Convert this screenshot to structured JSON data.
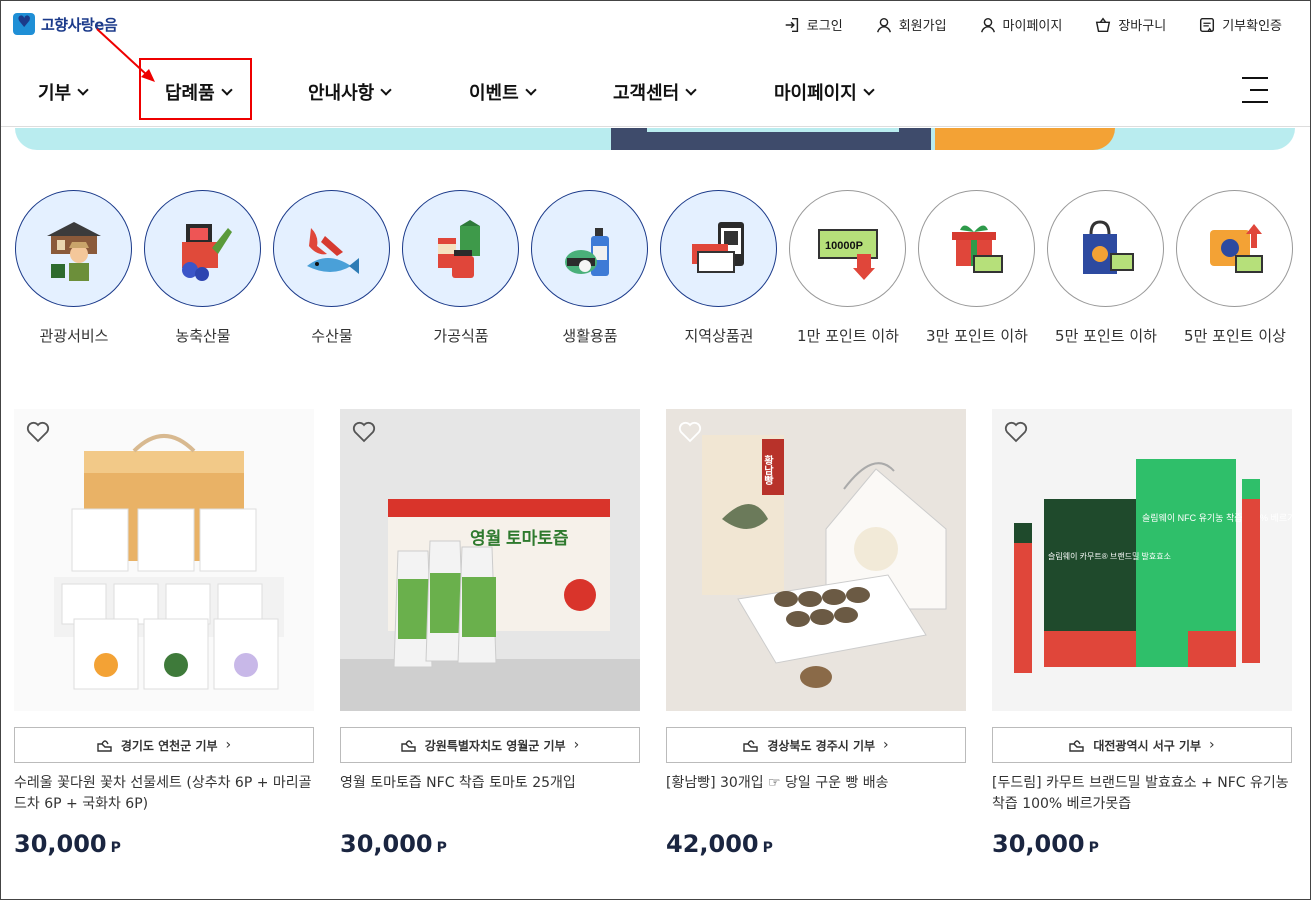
{
  "logo": {
    "text": "고향사랑e음"
  },
  "utility": [
    {
      "label": "로그인",
      "icon": "login-icon"
    },
    {
      "label": "회원가입",
      "icon": "user-icon"
    },
    {
      "label": "마이페이지",
      "icon": "user-icon"
    },
    {
      "label": "장바구니",
      "icon": "cart-icon"
    },
    {
      "label": "기부확인증",
      "icon": "certificate-icon"
    }
  ],
  "nav": [
    {
      "label": "기부"
    },
    {
      "label": "답례품"
    },
    {
      "label": "안내사항"
    },
    {
      "label": "이벤트"
    },
    {
      "label": "고객센터"
    },
    {
      "label": "마이페이지"
    }
  ],
  "colors": {
    "brand_navy": "#1b3a8a",
    "highlight_red": "#e00000",
    "category_bg": "#e4f0ff",
    "banner_cyan": "#b9ecef"
  },
  "categories": [
    {
      "label": "관광서비스",
      "icon": "tourism-icon"
    },
    {
      "label": "농축산물",
      "icon": "farm-produce-icon"
    },
    {
      "label": "수산물",
      "icon": "seafood-icon"
    },
    {
      "label": "가공식품",
      "icon": "processed-food-icon"
    },
    {
      "label": "생활용품",
      "icon": "household-goods-icon"
    },
    {
      "label": "지역상품권",
      "icon": "voucher-icon"
    },
    {
      "label": "1만 포인트 이하",
      "icon": "points-10000-icon"
    },
    {
      "label": "3만 포인트 이하",
      "icon": "gift-box-icon"
    },
    {
      "label": "5만 포인트 이하",
      "icon": "shopping-bag-icon"
    },
    {
      "label": "5만 포인트 이상",
      "icon": "gift-upgrade-icon"
    }
  ],
  "category_icon_texts": {
    "points_amount": "10000P"
  },
  "products": [
    {
      "region": "경기도 연천군 기부",
      "name": "수레울 꽃다원 꽃차 선물세트 (상추차 6P + 마리골드차 6P + 국화차 6P)",
      "price": "30,000",
      "unit": "P"
    },
    {
      "region": "강원특별자치도 영월군 기부",
      "name": "영월 토마토즙 NFC 착즙 토마토 25개입",
      "price": "30,000",
      "unit": "P"
    },
    {
      "region": "경상북도 경주시 기부",
      "name": "[황남빵] 30개입 ☞ 당일 구운 빵 배송",
      "price": "42,000",
      "unit": "P"
    },
    {
      "region": "대전광역시 서구 기부",
      "name": "[두드림] 카무트 브랜드밀 발효효소 + NFC 유기농 착즙 100% 베르가못즙",
      "price": "30,000",
      "unit": "P"
    }
  ],
  "product_image_texts": {
    "tomato_box": "영월 토마토즙",
    "bread_box": "황남빵",
    "slimway_box": "슬림웨이 카무트® 브랜드밀 발효효소",
    "slimway_box2": "슬림웨이 NFC 유기농 착즙 100% 베르가못즙"
  }
}
